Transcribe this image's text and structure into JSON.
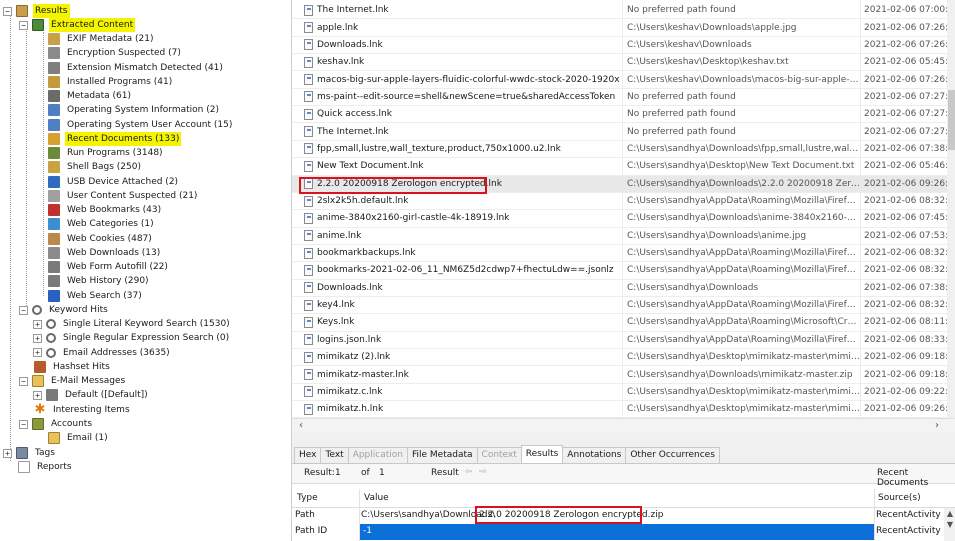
{
  "tree": {
    "results": "Results",
    "extracted_content": "Extracted Content",
    "items": [
      {
        "label": "EXIF Metadata (21)",
        "icon": "exif-icon",
        "color": "#c9a04a"
      },
      {
        "label": "Encryption Suspected (7)",
        "icon": "encryption-icon",
        "color": "#8a8a8a"
      },
      {
        "label": "Extension Mismatch Detected (41)",
        "icon": "extension-mismatch-icon",
        "color": "#7e7e7e"
      },
      {
        "label": "Installed Programs (41)",
        "icon": "installed-programs-icon",
        "color": "#c59a3b"
      },
      {
        "label": "Metadata (61)",
        "icon": "metadata-icon",
        "color": "#6a6a6a"
      },
      {
        "label": "Operating System Information (2)",
        "icon": "os-info-icon",
        "color": "#4f7fc2"
      },
      {
        "label": "Operating System User Account (15)",
        "icon": "os-user-account-icon",
        "color": "#4f7fc2"
      },
      {
        "label": "Recent Documents (133)",
        "icon": "recent-documents-icon",
        "color": "#d6a12e"
      },
      {
        "label": "Run Programs (3148)",
        "icon": "run-programs-icon",
        "color": "#6b8a3a"
      },
      {
        "label": "Shell Bags (250)",
        "icon": "shell-bags-icon",
        "color": "#c7a441"
      },
      {
        "label": "USB Device Attached (2)",
        "icon": "usb-icon",
        "color": "#2f6cbf"
      },
      {
        "label": "User Content Suspected (21)",
        "icon": "user-content-icon",
        "color": "#a0a0a0"
      },
      {
        "label": "Web Bookmarks (43)",
        "icon": "bookmark-icon",
        "color": "#c0322e"
      },
      {
        "label": "Web Categories (1)",
        "icon": "web-categories-icon",
        "color": "#3d8fd1"
      },
      {
        "label": "Web Cookies (487)",
        "icon": "cookie-icon",
        "color": "#b98a4c"
      },
      {
        "label": "Web Downloads (13)",
        "icon": "web-downloads-icon",
        "color": "#8a8a8a"
      },
      {
        "label": "Web Form Autofill (22)",
        "icon": "form-autofill-icon",
        "color": "#7a7a7a"
      },
      {
        "label": "Web History (290)",
        "icon": "web-history-icon",
        "color": "#7a7a7a"
      },
      {
        "label": "Web Search (37)",
        "icon": "web-search-icon",
        "color": "#2a5fbf"
      }
    ],
    "keyword_hits": "Keyword Hits",
    "keyword_items": [
      "Single Literal Keyword Search (1530)",
      "Single Regular Expression Search (0)",
      "Email Addresses (3635)"
    ],
    "hashset_hits": "Hashset Hits",
    "email_messages": "E-Mail Messages",
    "email_default": "Default ([Default])",
    "interesting_items": "Interesting Items",
    "accounts": "Accounts",
    "accounts_email": "Email (1)",
    "tags": "Tags",
    "reports": "Reports"
  },
  "table": {
    "rows": [
      {
        "name": "The Internet.lnk",
        "path": "No preferred path found",
        "date": "2021-02-06 07:00:49"
      },
      {
        "name": "apple.lnk",
        "path": "C:\\Users\\keshav\\Downloads\\apple.jpg",
        "date": "2021-02-06 07:26:12"
      },
      {
        "name": "Downloads.lnk",
        "path": "C:\\Users\\keshav\\Downloads",
        "date": "2021-02-06 07:26:12"
      },
      {
        "name": "keshav.lnk",
        "path": "C:\\Users\\keshav\\Desktop\\keshav.txt",
        "date": "2021-02-06 05:45:18"
      },
      {
        "name": "macos-big-sur-apple-layers-fluidic-colorful-wwdc-stock-2020-1920x",
        "path": "C:\\Users\\keshav\\Downloads\\macos-big-sur-apple-layers-fl...",
        "date": "2021-02-06 07:26:12"
      },
      {
        "name": "ms-paint--edit-source=shell&newScene=true&sharedAccessToken",
        "path": "No preferred path found",
        "date": "2021-02-06 07:27:40"
      },
      {
        "name": "Quick access.lnk",
        "path": "No preferred path found",
        "date": "2021-02-06 07:27:3"
      },
      {
        "name": "The Internet.lnk",
        "path": "No preferred path found",
        "date": "2021-02-06 07:27:40"
      },
      {
        "name": "fpp,small,lustre,wall_texture,product,750x1000.u2.lnk",
        "path": "C:\\Users\\sandhya\\Downloads\\fpp,small,lustre,wall_textur...",
        "date": "2021-02-06 07:38:22"
      },
      {
        "name": "New Text Document.lnk",
        "path": "C:\\Users\\sandhya\\Desktop\\New Text Document.txt",
        "date": "2021-02-06 05:46:19"
      },
      {
        "name": "2.2.0 20200918 Zerologon encrypted.lnk",
        "path": "C:\\Users\\sandhya\\Downloads\\2.2.0 20200918 Zerologon e...",
        "date": "2021-02-06 09:26:29"
      },
      {
        "name": "2slx2k5h.default.lnk",
        "path": "C:\\Users\\sandhya\\AppData\\Roaming\\Mozilla\\Firefox\\Profil...",
        "date": "2021-02-06 08:32:24"
      },
      {
        "name": "anime-3840x2160-girl-castle-4k-18919.lnk",
        "path": "C:\\Users\\sandhya\\Downloads\\anime-3840x2160-girl-castle...",
        "date": "2021-02-06 07:45:57"
      },
      {
        "name": "anime.lnk",
        "path": "C:\\Users\\sandhya\\Downloads\\anime.jpg",
        "date": "2021-02-06 07:53:04"
      },
      {
        "name": "bookmarkbackups.lnk",
        "path": "C:\\Users\\sandhya\\AppData\\Roaming\\Mozilla\\Firefox\\Profil...",
        "date": "2021-02-06 08:32:37"
      },
      {
        "name": "bookmarks-2021-02-06_11_NM6Z5d2cdwp7+fhectuLdw==.jsonlz",
        "path": "C:\\Users\\sandhya\\AppData\\Roaming\\Mozilla\\Firefox\\Profil...",
        "date": "2021-02-06 08:32:37"
      },
      {
        "name": "Downloads.lnk",
        "path": "C:\\Users\\sandhya\\Downloads",
        "date": "2021-02-06 07:38:22"
      },
      {
        "name": "key4.lnk",
        "path": "C:\\Users\\sandhya\\AppData\\Roaming\\Mozilla\\Firefox\\Profil...",
        "date": "2021-02-06 08:32:56"
      },
      {
        "name": "Keys.lnk",
        "path": "C:\\Users\\sandhya\\AppData\\Roaming\\Microsoft\\Crypto\\Keys",
        "date": "2021-02-06 08:11:22"
      },
      {
        "name": "logins.json.lnk",
        "path": "C:\\Users\\sandhya\\AppData\\Roaming\\Mozilla\\Firefox\\Profil...",
        "date": "2021-02-06 08:33:57"
      },
      {
        "name": "mimikatz (2).lnk",
        "path": "C:\\Users\\sandhya\\Desktop\\mimikatz-master\\mimikatz-mast...",
        "date": "2021-02-06 09:18:47"
      },
      {
        "name": "mimikatz-master.lnk",
        "path": "C:\\Users\\sandhya\\Downloads\\mimikatz-master.zip",
        "date": "2021-02-06 09:18:10"
      },
      {
        "name": "mimikatz.c.lnk",
        "path": "C:\\Users\\sandhya\\Desktop\\mimikatz-master\\mimikatz-mast...",
        "date": "2021-02-06 09:22:11"
      },
      {
        "name": "mimikatz.h.lnk",
        "path": "C:\\Users\\sandhya\\Desktop\\mimikatz-master\\mimikatz-mast...",
        "date": "2021-02-06 09:26:3"
      }
    ]
  },
  "tabs": [
    "Hex",
    "Text",
    "Application",
    "File Metadata",
    "Context",
    "Results",
    "Annotations",
    "Other Occurrences"
  ],
  "navbar": {
    "result_label": "Result:",
    "result_value": "1",
    "of_label": "of",
    "of_value": "1",
    "result_nav_label": "Result",
    "category": "Recent Documents"
  },
  "detail": {
    "headers": {
      "type": "Type",
      "value": "Value",
      "sources": "Source(s)"
    },
    "rows": [
      {
        "type": "Path",
        "value_prefix": "C:\\Users\\sandhya\\Downloads\\",
        "value_highlight": "2.2.0 20200918 Zerologon encrypted.zip",
        "source": "RecentActivity"
      },
      {
        "type": "Path ID",
        "value": "-1",
        "source": "RecentActivity"
      }
    ]
  },
  "colors": {
    "highlight": "#f4f400",
    "red_box": "#d9121b",
    "selection": "#0a6fd6"
  }
}
